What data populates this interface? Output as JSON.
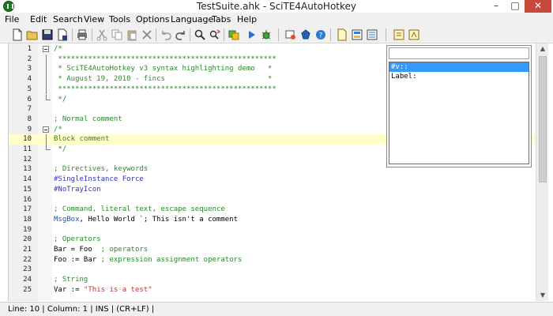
{
  "window": {
    "title": "TestSuite.ahk - SciTE4AutoHotkey",
    "min": "–",
    "max": "□",
    "close": "✕"
  },
  "menu": [
    "File",
    "Edit",
    "Search",
    "View",
    "Tools",
    "Options",
    "Language",
    "Tabs",
    "Help"
  ],
  "toolbar_icons": [
    "new-file-icon",
    "open-folder-icon",
    "save-icon",
    "save-as-icon",
    "print-icon",
    "cut-icon",
    "copy-icon",
    "paste-icon",
    "delete-icon",
    "undo-icon",
    "redo-icon",
    "find-icon",
    "replace-icon",
    "compile-icon",
    "run-icon",
    "debug-icon",
    "window-spy-icon",
    "globe-icon",
    "help-icon",
    "toolbox-icon",
    "reference-icon",
    "properties-icon",
    "settings-icon",
    "about-icon"
  ],
  "lines": [
    {
      "n": "1",
      "text": "/*",
      "style": "comment",
      "fold": "start"
    },
    {
      "n": "2",
      "text": " ***************************************************",
      "style": "comment",
      "fold": "mid"
    },
    {
      "n": "3",
      "text": " * SciTE4AutoHotkey v3 syntax highlighting demo   *",
      "style": "comment",
      "fold": "mid"
    },
    {
      "n": "4",
      "text": " * August 19, 2010 - fincs                        *",
      "style": "comment",
      "fold": "mid"
    },
    {
      "n": "5",
      "text": " ***************************************************",
      "style": "comment",
      "fold": "mid"
    },
    {
      "n": "6",
      "text": " */",
      "style": "comment",
      "fold": "end"
    },
    {
      "n": "7",
      "text": "",
      "style": "plain",
      "fold": ""
    },
    {
      "n": "8",
      "text": "; Normal comment",
      "style": "comment",
      "fold": ""
    },
    {
      "n": "9",
      "text": "/*",
      "style": "comment",
      "fold": "start"
    },
    {
      "n": "10",
      "text": "Block comment",
      "style": "comment",
      "fold": "mid",
      "caret": true
    },
    {
      "n": "11",
      "text": " */",
      "style": "comment",
      "fold": "end"
    },
    {
      "n": "12",
      "text": "",
      "style": "plain",
      "fold": ""
    },
    {
      "n": "13",
      "text": "; Directives, keywords",
      "style": "comment",
      "fold": ""
    },
    {
      "n": "14",
      "text": "#SingleInstance Force",
      "style": "directive",
      "fold": ""
    },
    {
      "n": "15",
      "text": "#NoTrayIcon",
      "style": "directive",
      "fold": ""
    },
    {
      "n": "16",
      "text": "",
      "style": "plain",
      "fold": ""
    },
    {
      "n": "17",
      "text": "; Command, literal text, escape sequence",
      "style": "comment",
      "fold": ""
    },
    {
      "n": "18",
      "segments": [
        {
          "t": "MsgBox",
          "s": "cmd"
        },
        {
          "t": ", Hello World `; This isn't a comment",
          "s": "plain"
        }
      ],
      "fold": ""
    },
    {
      "n": "19",
      "text": "",
      "style": "plain",
      "fold": ""
    },
    {
      "n": "20",
      "text": "; Operators",
      "style": "comment",
      "fold": ""
    },
    {
      "n": "21",
      "segments": [
        {
          "t": "Bar = Foo  ",
          "s": "plain"
        },
        {
          "t": "; operators",
          "s": "comment"
        }
      ],
      "fold": ""
    },
    {
      "n": "22",
      "segments": [
        {
          "t": "Foo := Bar ",
          "s": "plain"
        },
        {
          "t": "; expression assignment operators",
          "s": "comment"
        }
      ],
      "fold": ""
    },
    {
      "n": "23",
      "text": "",
      "style": "plain",
      "fold": ""
    },
    {
      "n": "24",
      "text": "; String",
      "style": "comment",
      "fold": ""
    },
    {
      "n": "25",
      "segments": [
        {
          "t": "Var := ",
          "s": "plain"
        },
        {
          "t": "\"This is a test\"",
          "s": "string"
        }
      ],
      "fold": ""
    }
  ],
  "autocomplete": {
    "items": [
      "#v::",
      "Label:"
    ],
    "selected_index": 0
  },
  "status": {
    "text": "Line: 10 | Column: 1 | INS | (CR+LF) |"
  },
  "colors": {
    "comment": "#2a8a2a",
    "directive": "#3333bb",
    "cmd": "#1f55b3",
    "string": "#b03a3a",
    "caret_line": "#ffffc9",
    "selection": "#3399ff"
  }
}
